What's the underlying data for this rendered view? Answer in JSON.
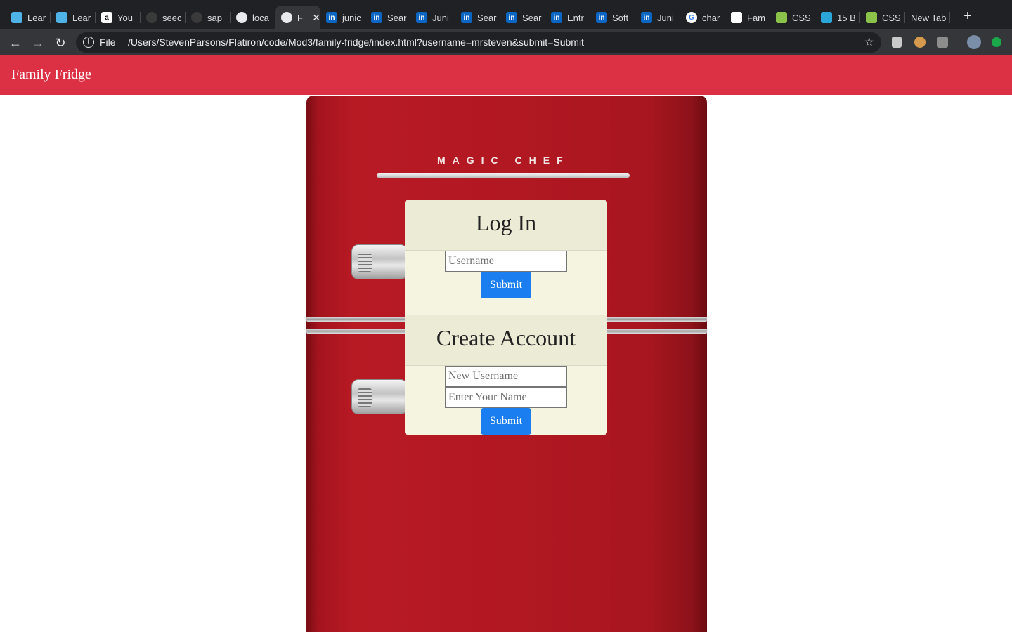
{
  "browser": {
    "tabs": [
      {
        "title": "Lear",
        "icon": "lightning-icon",
        "color": "#4fb3e8"
      },
      {
        "title": "Lear",
        "icon": "lightning-icon",
        "color": "#4fb3e8"
      },
      {
        "title": "You",
        "icon": "amazon-icon",
        "color": "#ffffff"
      },
      {
        "title": "seec",
        "icon": "github-icon",
        "color": "#3a3a3a"
      },
      {
        "title": "sap",
        "icon": "github-icon",
        "color": "#3a3a3a"
      },
      {
        "title": "loca",
        "icon": "globe-icon",
        "color": "#e8eaed"
      },
      {
        "title": "F",
        "icon": "globe-icon",
        "color": "#e8eaed",
        "active": true
      },
      {
        "title": "junic",
        "icon": "linkedin-icon",
        "color": "#0a66c2"
      },
      {
        "title": "Sear",
        "icon": "linkedin-icon",
        "color": "#0a66c2"
      },
      {
        "title": "Juni",
        "icon": "linkedin-icon",
        "color": "#0a66c2"
      },
      {
        "title": "Sear",
        "icon": "linkedin-icon",
        "color": "#0a66c2"
      },
      {
        "title": "Sear",
        "icon": "linkedin-icon",
        "color": "#0a66c2"
      },
      {
        "title": "Entr",
        "icon": "linkedin-icon",
        "color": "#0a66c2"
      },
      {
        "title": "Soft",
        "icon": "linkedin-icon",
        "color": "#0a66c2"
      },
      {
        "title": "Juni",
        "icon": "linkedin-icon",
        "color": "#0a66c2"
      },
      {
        "title": "char",
        "icon": "google-icon",
        "color": "#ffffff"
      },
      {
        "title": "Fam",
        "icon": "trello-icon",
        "color": "#ffffff"
      },
      {
        "title": "CSS",
        "icon": "css-tricks-icon",
        "color": "#8bc34a"
      },
      {
        "title": "15 B",
        "icon": "shield-icon",
        "color": "#2aa7d8"
      },
      {
        "title": "CSS",
        "icon": "css-tricks-icon",
        "color": "#8bc34a"
      },
      {
        "title": "New Tab",
        "icon": "",
        "color": ""
      }
    ],
    "file_label": "File",
    "url": "/Users/StevenParsons/Flatiron/code/Mod3/family-fridge/index.html?username=mrsteven&submit=Submit"
  },
  "app": {
    "brand": "Family Fridge",
    "fridge_brand": "MAGIC CHEF",
    "login": {
      "title": "Log In",
      "username_placeholder": "Username",
      "submit_label": "Submit"
    },
    "create": {
      "title": "Create Account",
      "new_username_placeholder": "New Username",
      "name_placeholder": "Enter Your Name",
      "submit_label": "Submit"
    },
    "colors": {
      "navbar": "#dc3045",
      "button": "#1a7df0",
      "card": "#f4f4e0"
    }
  }
}
